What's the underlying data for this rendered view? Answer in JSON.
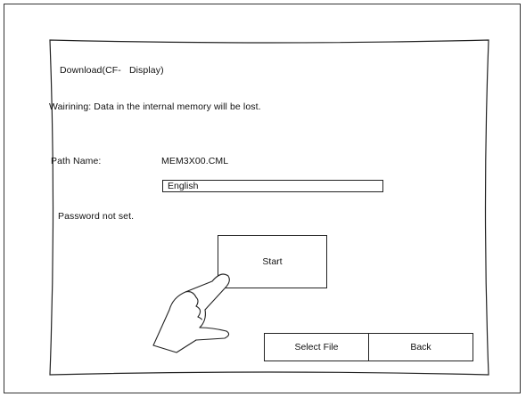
{
  "title": "Download(CF-   Display)",
  "warning": "Wairining: Data in the internal memory will be lost.",
  "path": {
    "label": "Path Name:",
    "value": "MEM3X00.CML"
  },
  "language_field": "English",
  "password_status": "Password not set.",
  "buttons": {
    "start": "Start",
    "select_file": "Select File",
    "back": "Back"
  },
  "icons": {
    "touch": "pointing-hand-icon"
  }
}
